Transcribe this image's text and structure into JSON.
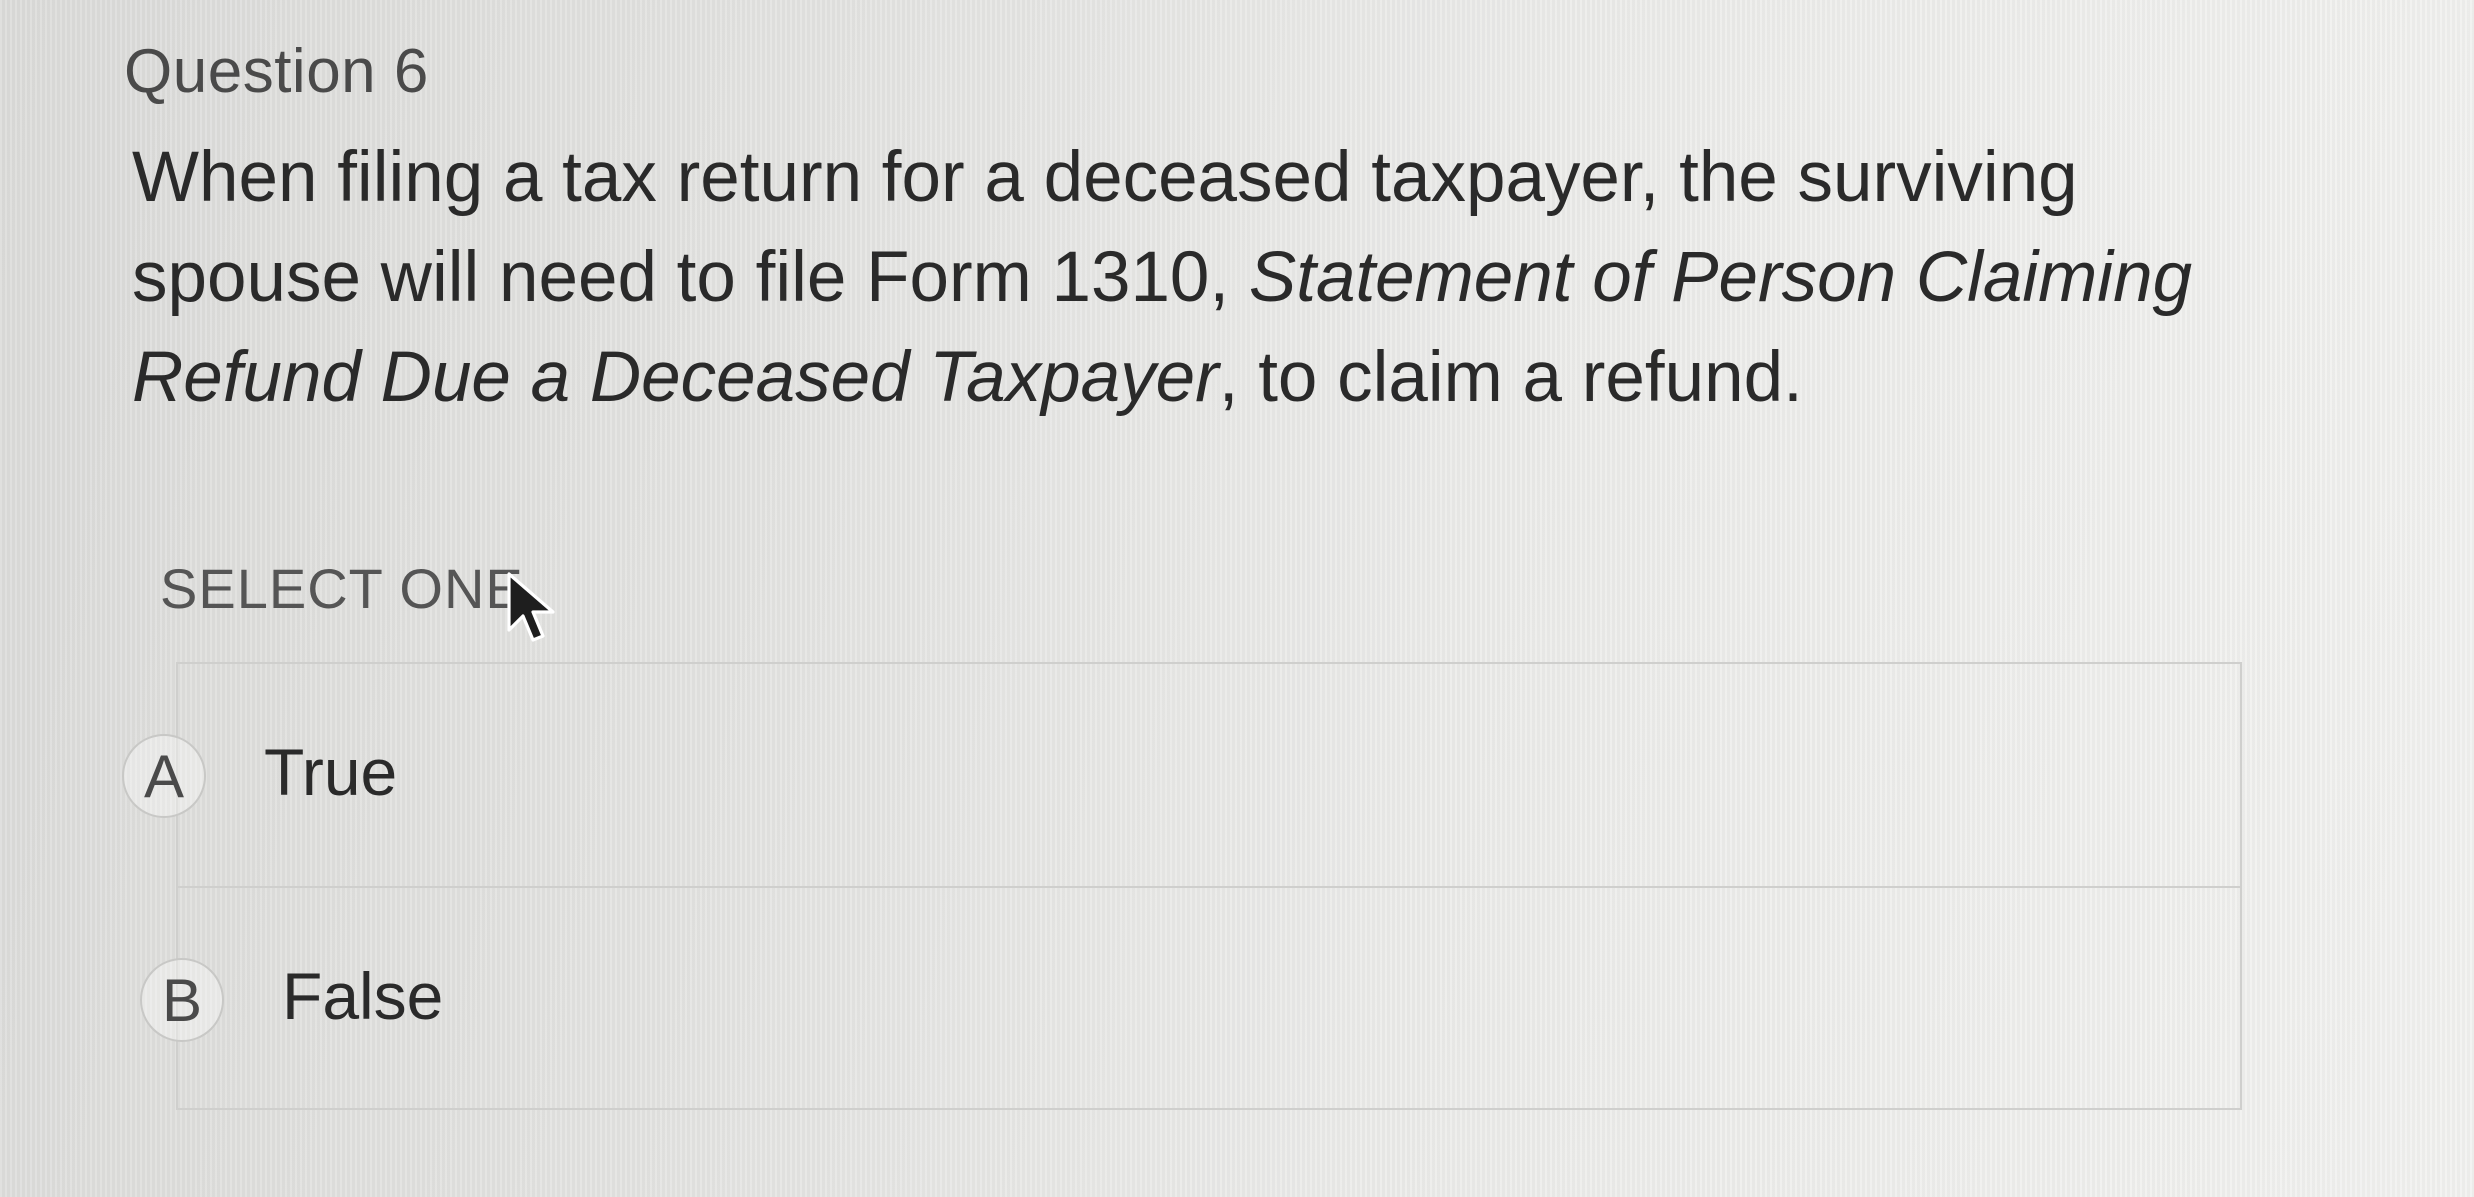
{
  "question": {
    "number_label": "Question 6",
    "text_part1": "When filing a tax return for a deceased taxpayer, the surviving spouse will need to file Form 1310, ",
    "text_italic": "Statement of Person Claiming Refund Due a Deceased Taxpayer",
    "text_part2": ", to claim a refund."
  },
  "instruction": "SELECT ONE",
  "options": [
    {
      "letter": "A",
      "label": "True"
    },
    {
      "letter": "B",
      "label": "False"
    }
  ],
  "colors": {
    "text": "#2a2a2a",
    "muted_text": "#4a4a4a",
    "border": "#cfcfcd",
    "background": "#e6e6e4"
  },
  "icons": {
    "cursor": "mouse-pointer-icon"
  }
}
